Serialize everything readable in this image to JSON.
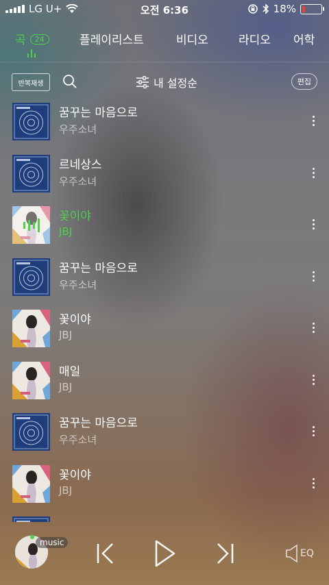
{
  "status": {
    "carrier": "LG U+",
    "time": "오전 6:36",
    "battery": "18%",
    "battery_level": 0.18
  },
  "tabs": [
    {
      "label": "곡",
      "count": "24"
    },
    {
      "label": "플레이리스트"
    },
    {
      "label": "비디오"
    },
    {
      "label": "라디오"
    },
    {
      "label": "어학"
    }
  ],
  "toolbar": {
    "repeat_label": "반복재생",
    "sort_label": "내 설정순",
    "edit_label": "편집"
  },
  "songs": [
    {
      "title": "꿈꾸는 마음으로",
      "artist": "우주소녀",
      "art": "blue"
    },
    {
      "title": "르네상스",
      "artist": "우주소녀",
      "art": "blue"
    },
    {
      "title": "꽃이야",
      "artist": "JBJ",
      "art": "pink",
      "playing": true
    },
    {
      "title": "꿈꾸는 마음으로",
      "artist": "우주소녀",
      "art": "blue"
    },
    {
      "title": "꽃이야",
      "artist": "JBJ",
      "art": "pink"
    },
    {
      "title": "매일",
      "artist": "JBJ",
      "art": "pink"
    },
    {
      "title": "꿈꾸는 마음으로",
      "artist": "우주소녀",
      "art": "blue"
    },
    {
      "title": "꽃이야",
      "artist": "JBJ",
      "art": "pink"
    }
  ],
  "player": {
    "tag": "music",
    "eq_label": "EQ"
  },
  "colors": {
    "accent": "#4fd04f",
    "battery_low": "#ff3b30"
  }
}
